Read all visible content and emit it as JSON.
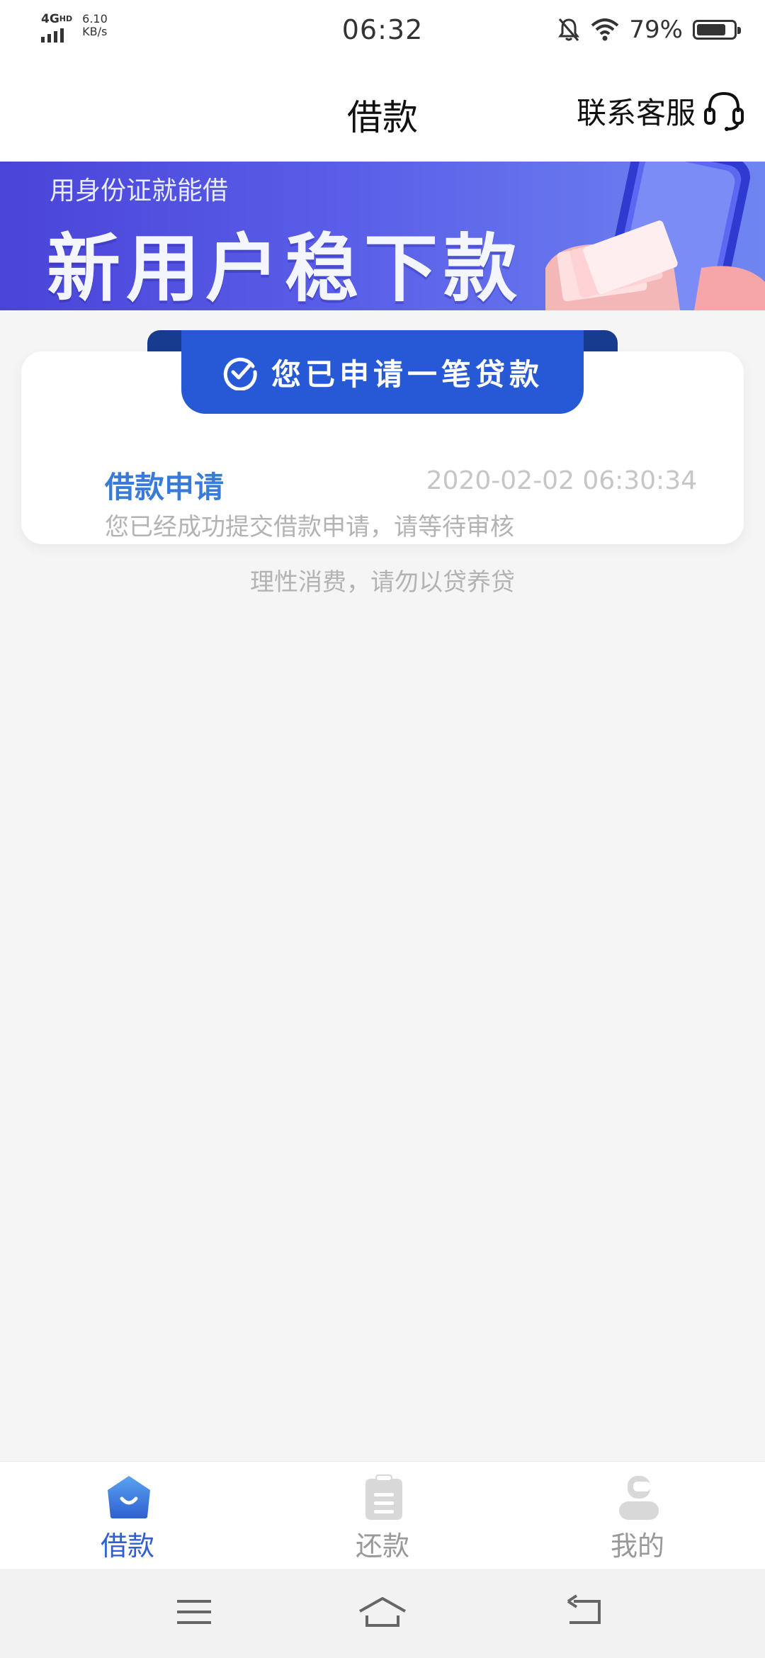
{
  "status_bar": {
    "network": "4G",
    "network_hd": "HD",
    "speed_value": "6.10",
    "speed_unit": "KB/s",
    "time": "06:32",
    "battery_percent_text": "79%",
    "battery_level": 0.79
  },
  "header": {
    "title": "借款",
    "support_label": "联系客服",
    "support_icon": "headset-icon"
  },
  "banner": {
    "subtitle": "用身份证就能借",
    "headline": "新用户稳下款"
  },
  "application_card": {
    "ribbon_label": "您已申请一笔贷款",
    "ribbon_icon": "check-circle-icon",
    "title": "借款申请",
    "timestamp": "2020-02-02 06:30:34",
    "description": "您已经成功提交借款申请，请等待审核"
  },
  "footnote": "理性消费，请勿以贷养贷",
  "tabs": [
    {
      "label": "借款",
      "icon": "home-bag-icon",
      "active": true
    },
    {
      "label": "还款",
      "icon": "clipboard-icon",
      "active": false
    },
    {
      "label": "我的",
      "icon": "profile-icon",
      "active": false
    }
  ],
  "system_nav": {
    "menu_icon": "menu-icon",
    "home_icon": "home-icon",
    "back_icon": "back-icon"
  },
  "colors": {
    "accent": "#2f5fd0",
    "ribbon": "#2759d6",
    "card_title": "#3a7bd8",
    "banner_start": "#4a44d8",
    "banner_end": "#6f86f0"
  }
}
